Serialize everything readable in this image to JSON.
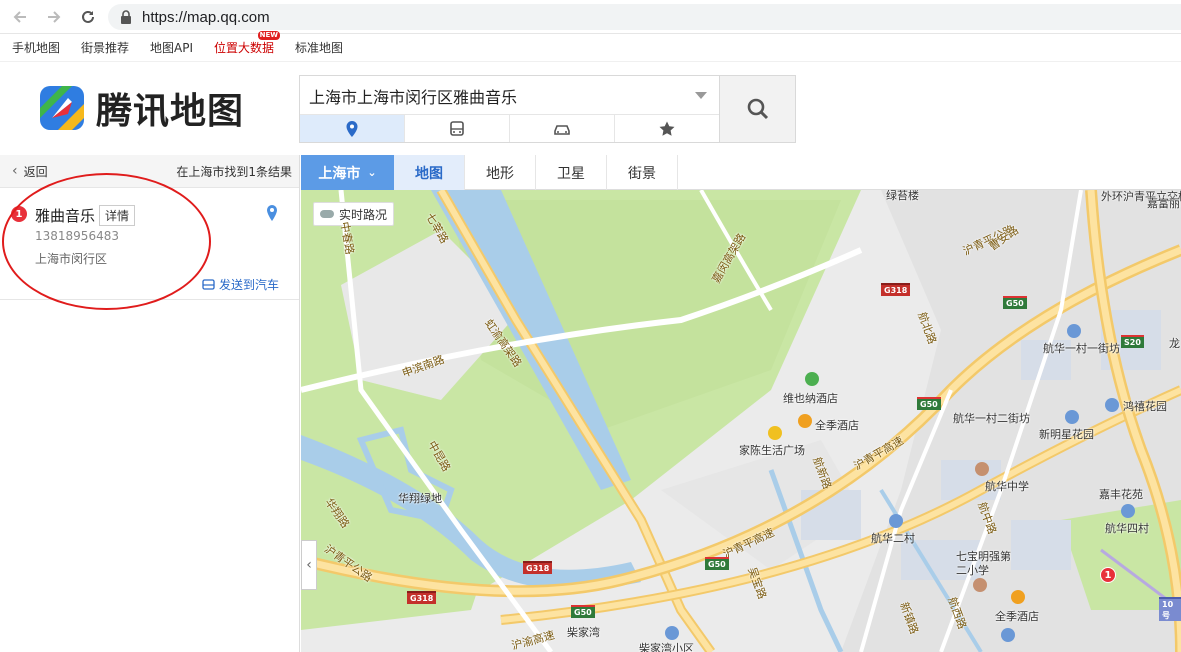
{
  "browser": {
    "url": "https://map.qq.com"
  },
  "bookmarks": [
    {
      "label": "手机地图"
    },
    {
      "label": "街景推荐"
    },
    {
      "label": "地图API"
    },
    {
      "label": "位置大数据",
      "badge": "NEW"
    },
    {
      "label": "标准地图"
    }
  ],
  "header": {
    "logo_text": "腾讯地图",
    "search_value": "上海市上海市闵行区雅曲音乐",
    "modes": [
      "location-icon",
      "bus-icon",
      "car-icon",
      "star-icon"
    ]
  },
  "leftpanel": {
    "back_label": "返回",
    "result_summary": "在上海市找到1条结果",
    "result": {
      "index": "1",
      "name": "雅曲音乐",
      "detail_label": "详情",
      "phone": "13818956483",
      "address": "上海市闵行区",
      "send_label": "发送到汽车"
    }
  },
  "maptoolbar": {
    "city": "上海市",
    "tabs": [
      "地图",
      "地形",
      "卫星",
      "街景"
    ]
  },
  "map": {
    "traffic_label": "实时路况",
    "labels": {
      "l1": "绿苔楼",
      "l2": "外环沪青平立交桥",
      "l3": "嘉富丽",
      "l4": "沪青平公路",
      "l5": "七莘路",
      "l6": "中春路",
      "l7": "嘉闵高架路",
      "l8": "龙",
      "l9": "航华一村一街坊",
      "l10": "鸿禧花园",
      "l11": "航华一村二街坊",
      "l12": "新明星花园",
      "l13": "维也纳酒店",
      "l14": "全季酒店",
      "l15": "家陈生活广场",
      "l16": "航华中学",
      "l17": "嘉丰花苑",
      "l18": "航华四村",
      "l19": "航华二村",
      "l20": "七宝明强第二小学",
      "l21": "全季酒店",
      "l22": "申滨南路",
      "l23": "华翔绿地",
      "l24": "中昆路",
      "l25": "华翔路",
      "l26": "沪青平公路",
      "l27": "虹渝高架路",
      "l28": "沪渝高速",
      "l29": "柴家湾",
      "l30": "柴家湾小区",
      "l31": "航北路",
      "l32": "航新路",
      "l33": "航中路",
      "l34": "航西路",
      "l35": "沪青平高速",
      "l36": "吴宝路",
      "l37": "新镇路",
      "l38": "曹安路",
      "l39": "沪青平高速"
    },
    "shields": {
      "s1": "G318",
      "s2": "G50",
      "s3": "S20",
      "s4": "G50",
      "s5": "G318",
      "s6": "G50",
      "s7": "G318",
      "s8": "G50",
      "s9": "10号"
    },
    "marker_index": "1"
  }
}
